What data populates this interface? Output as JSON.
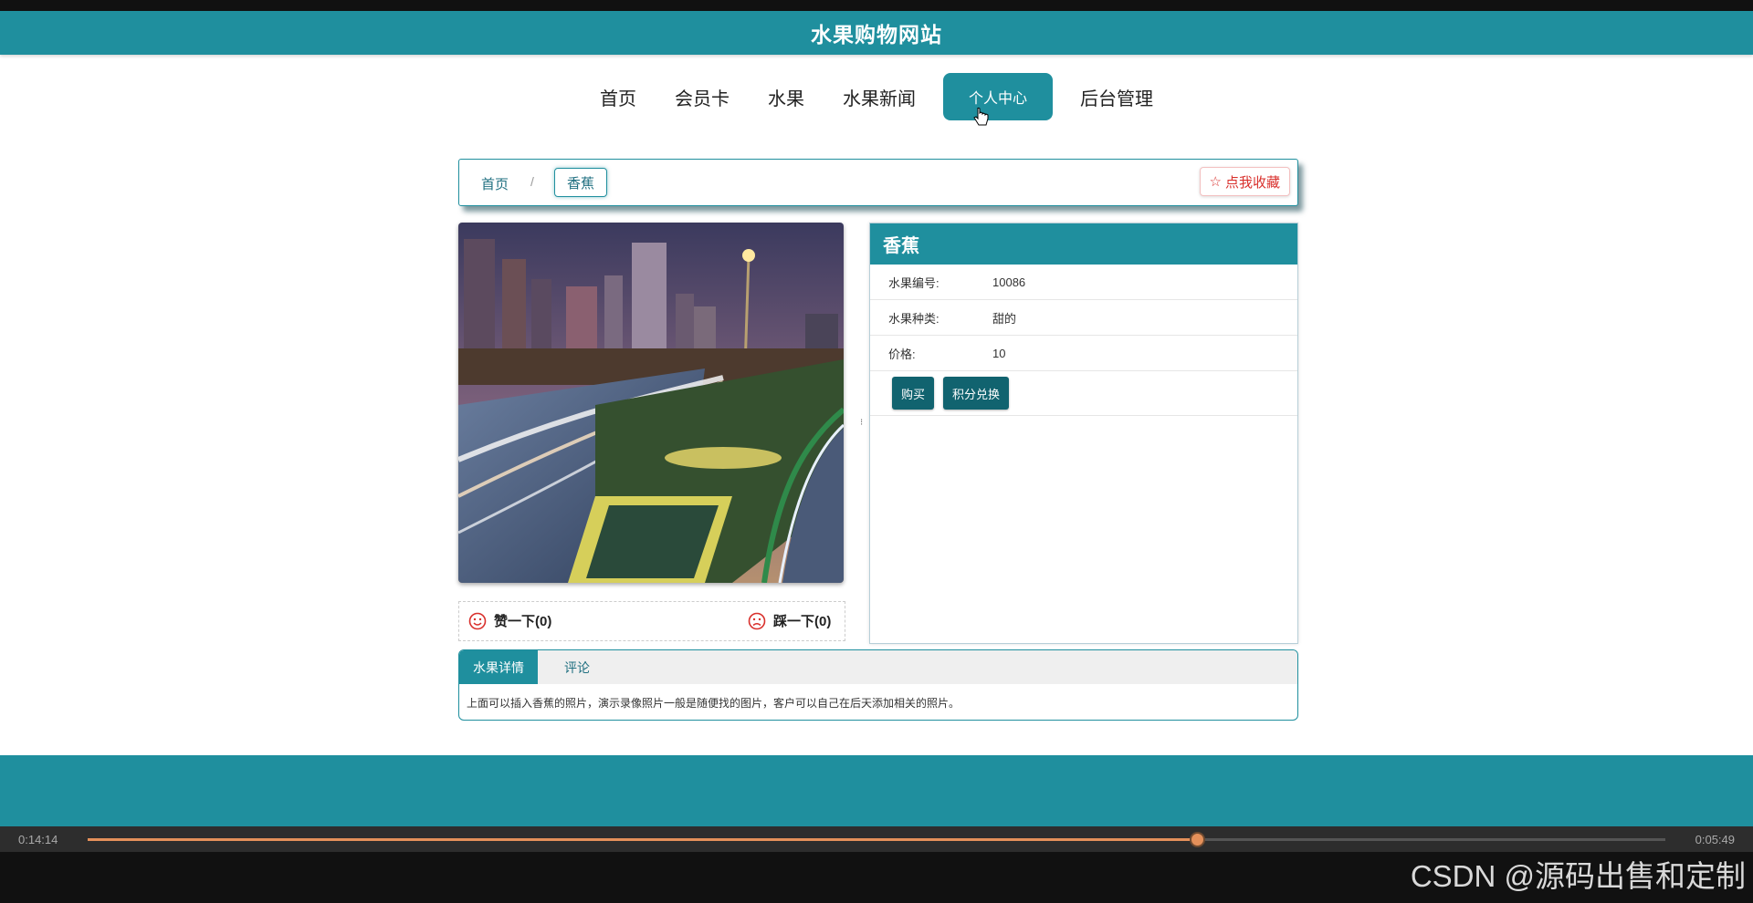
{
  "header": {
    "title": "水果购物网站"
  },
  "nav": {
    "items": [
      "首页",
      "会员卡",
      "水果",
      "水果新闻",
      "个人中心",
      "后台管理"
    ],
    "active_index": 4
  },
  "breadcrumb": {
    "home": "首页",
    "separator": "/",
    "current": "香蕉",
    "favorite_label": "点我收藏"
  },
  "votes": {
    "up_label": "赞一下(0)",
    "down_label": "踩一下(0)"
  },
  "product": {
    "name": "香蕉",
    "fields": [
      {
        "label": "水果编号:",
        "value": "10086"
      },
      {
        "label": "水果种类:",
        "value": "甜的"
      },
      {
        "label": "价格:",
        "value": "10"
      }
    ],
    "buy_label": "购买",
    "exchange_label": "积分兑换"
  },
  "tabs": {
    "items": [
      "水果详情",
      "评论"
    ],
    "active_index": 0,
    "content": "上面可以插入香蕉的照片，演示录像照片一般是随便找的图片，客户可以自己在后天添加相关的照片。"
  },
  "player": {
    "elapsed": "0:14:14",
    "remaining": "0:05:49",
    "progress": 0.703,
    "watermark": "CSDN @源码出售和定制"
  },
  "colors": {
    "accent": "#1f8f9e",
    "dark_button": "#11636f",
    "favorite": "#d9302c",
    "progress": "#e4905a"
  },
  "icons": {
    "favorite": "star-icon",
    "vote_up": "smile-icon",
    "vote_down": "frown-icon"
  }
}
